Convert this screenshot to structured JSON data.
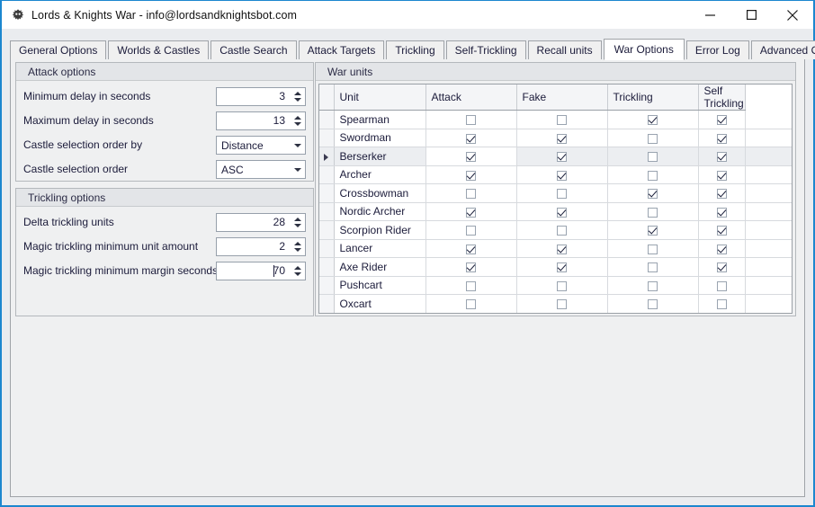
{
  "window": {
    "title": "Lords & Knights War - info@lordsandknightsbot.com",
    "icon": "app-knight-icon",
    "accent_color": "#1c87cf",
    "buttons": {
      "minimize": "minimize-icon",
      "maximize": "maximize-icon",
      "close": "close-icon"
    }
  },
  "tabs": [
    {
      "label": "General Options",
      "selected": false
    },
    {
      "label": "Worlds & Castles",
      "selected": false
    },
    {
      "label": "Castle Search",
      "selected": false
    },
    {
      "label": "Attack Targets",
      "selected": false
    },
    {
      "label": "Trickling",
      "selected": false
    },
    {
      "label": "Self-Trickling",
      "selected": false
    },
    {
      "label": "Recall units",
      "selected": false
    },
    {
      "label": "War Options",
      "selected": true
    },
    {
      "label": "Error Log",
      "selected": false
    },
    {
      "label": "Advanced Options",
      "selected": false
    }
  ],
  "attack_options": {
    "title": "Attack options",
    "fields": [
      {
        "label": "Minimum delay in seconds",
        "value": "3",
        "type": "spinner"
      },
      {
        "label": "Maximum delay in seconds",
        "value": "13",
        "type": "spinner"
      },
      {
        "label": "Castle selection order by",
        "value": "Distance",
        "type": "combo"
      },
      {
        "label": "Castle selection order",
        "value": "ASC",
        "type": "combo"
      }
    ]
  },
  "trickling_options": {
    "title": "Trickling options",
    "fields": [
      {
        "label": "Delta trickling units",
        "value": "28",
        "type": "spinner",
        "caret": false
      },
      {
        "label": "Magic trickling minimum unit amount",
        "value": "2",
        "type": "spinner",
        "caret": false
      },
      {
        "label": "Magic trickling minimum margin seconds",
        "value": "70",
        "type": "spinner",
        "caret": true
      }
    ]
  },
  "war_units": {
    "title": "War units",
    "columns": [
      "Unit",
      "Attack",
      "Fake",
      "Trickling",
      "Self Trickling"
    ],
    "rows": [
      {
        "unit": "Spearman",
        "attack": false,
        "fake": false,
        "trickling": true,
        "self_trickling": true,
        "selected": false
      },
      {
        "unit": "Swordman",
        "attack": true,
        "fake": true,
        "trickling": false,
        "self_trickling": true,
        "selected": false
      },
      {
        "unit": "Berserker",
        "attack": true,
        "fake": true,
        "trickling": false,
        "self_trickling": true,
        "selected": true
      },
      {
        "unit": "Archer",
        "attack": true,
        "fake": true,
        "trickling": false,
        "self_trickling": true,
        "selected": false
      },
      {
        "unit": "Crossbowman",
        "attack": false,
        "fake": false,
        "trickling": true,
        "self_trickling": true,
        "selected": false
      },
      {
        "unit": "Nordic Archer",
        "attack": true,
        "fake": true,
        "trickling": false,
        "self_trickling": true,
        "selected": false
      },
      {
        "unit": "Scorpion Rider",
        "attack": false,
        "fake": false,
        "trickling": true,
        "self_trickling": true,
        "selected": false
      },
      {
        "unit": "Lancer",
        "attack": true,
        "fake": true,
        "trickling": false,
        "self_trickling": true,
        "selected": false
      },
      {
        "unit": "Axe Rider",
        "attack": true,
        "fake": true,
        "trickling": false,
        "self_trickling": true,
        "selected": false
      },
      {
        "unit": "Pushcart",
        "attack": false,
        "fake": false,
        "trickling": false,
        "self_trickling": false,
        "selected": false
      },
      {
        "unit": "Oxcart",
        "attack": false,
        "fake": false,
        "trickling": false,
        "self_trickling": false,
        "selected": false
      }
    ]
  }
}
